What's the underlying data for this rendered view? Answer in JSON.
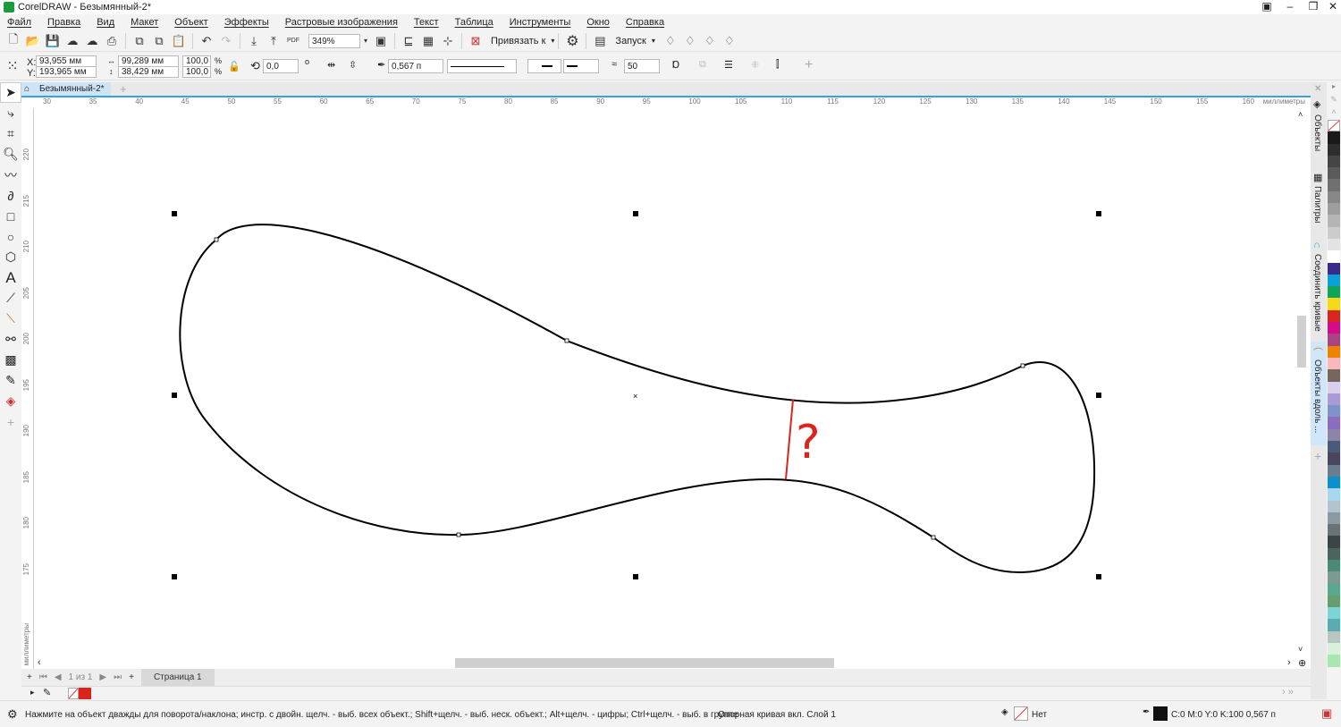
{
  "window": {
    "title": "CorelDRAW - Безымянный-2*"
  },
  "menu": [
    "Файл",
    "Правка",
    "Вид",
    "Макет",
    "Объект",
    "Эффекты",
    "Растровые изображения",
    "Текст",
    "Таблица",
    "Инструменты",
    "Окно",
    "Справка"
  ],
  "toolbar": {
    "zoom": "349%",
    "snap_label": "Привязать к",
    "launch_label": "Запуск"
  },
  "property_bar": {
    "x": "93,955 мм",
    "y": "193,965 мм",
    "x_label": "X:",
    "y_label": "Y:",
    "width": "99,289 мм",
    "height": "38,429 мм",
    "scale_x": "100,0",
    "scale_y": "100,0",
    "pct": "%",
    "rotation": "0,0",
    "deg": "o",
    "outline_width": "0,567 п",
    "smoothing": "50"
  },
  "document": {
    "tab": "Безымянный-2*"
  },
  "ruler": {
    "h_ticks": [
      "30",
      "35",
      "40",
      "45",
      "50",
      "55",
      "60",
      "65",
      "70",
      "75",
      "80",
      "85",
      "90",
      "95",
      "100",
      "105",
      "110",
      "115",
      "120",
      "125",
      "130",
      "135",
      "140",
      "145",
      "150",
      "155",
      "160"
    ],
    "h_unit": "миллиметры",
    "v_ticks": [
      "220",
      "215",
      "210",
      "205",
      "200",
      "195",
      "190",
      "185",
      "180",
      "175"
    ],
    "v_unit": "миллиметры"
  },
  "canvas": {
    "annotation": "?",
    "annotation_color": "#d9261c",
    "curve_color": "#000000"
  },
  "dockers": [
    "Объекты",
    "Палитры",
    "Соединить кривые",
    "Объекты вдоль ..."
  ],
  "palette": [
    "#1a1a1a",
    "#2e2e2e",
    "#454545",
    "#5a5a5a",
    "#707070",
    "#878787",
    "#9e9e9e",
    "#b5b5b5",
    "#cccccc",
    "#e3e3e3",
    "#ffffff",
    "#3a2a8e",
    "#0aa0d8",
    "#0ea55a",
    "#f7d915",
    "#d8261d",
    "#d70b88",
    "#a94384",
    "#ef8200",
    "#f9b9bb",
    "#77665e",
    "#d9d0ee",
    "#ab9ad8",
    "#7c93cc",
    "#8a6cc0",
    "#8e83a8",
    "#4a5a7c",
    "#4a4660",
    "#6a7d8e",
    "#0a8fcf",
    "#a8d8ef",
    "#b2c4d0",
    "#8a9aa2",
    "#6a7478",
    "#3c4446",
    "#4a6460",
    "#4a8a76",
    "#7a9a92",
    "#5aa890",
    "#62a070",
    "#7ad4d8",
    "#58acb2",
    "#b8c8c0",
    "#d8f0dc",
    "#a8e8b0"
  ],
  "page_nav": {
    "position": "1",
    "of": "из",
    "total": "1",
    "page_tab": "Страница 1"
  },
  "status": {
    "hint": "Нажмите на объект дважды для поворота/наклона; инстр. с двойн. щелч. - выб. всех объект.; Shift+щелч. - выб. неск. объект.; Alt+щелч. - цифры; Ctrl+щелч. - выб. в группе",
    "object_info": "Опорная кривая вкл. Слой 1",
    "fill": "Нет",
    "outline": "C:0 M:0 Y:0 K:100  0,567 п"
  }
}
